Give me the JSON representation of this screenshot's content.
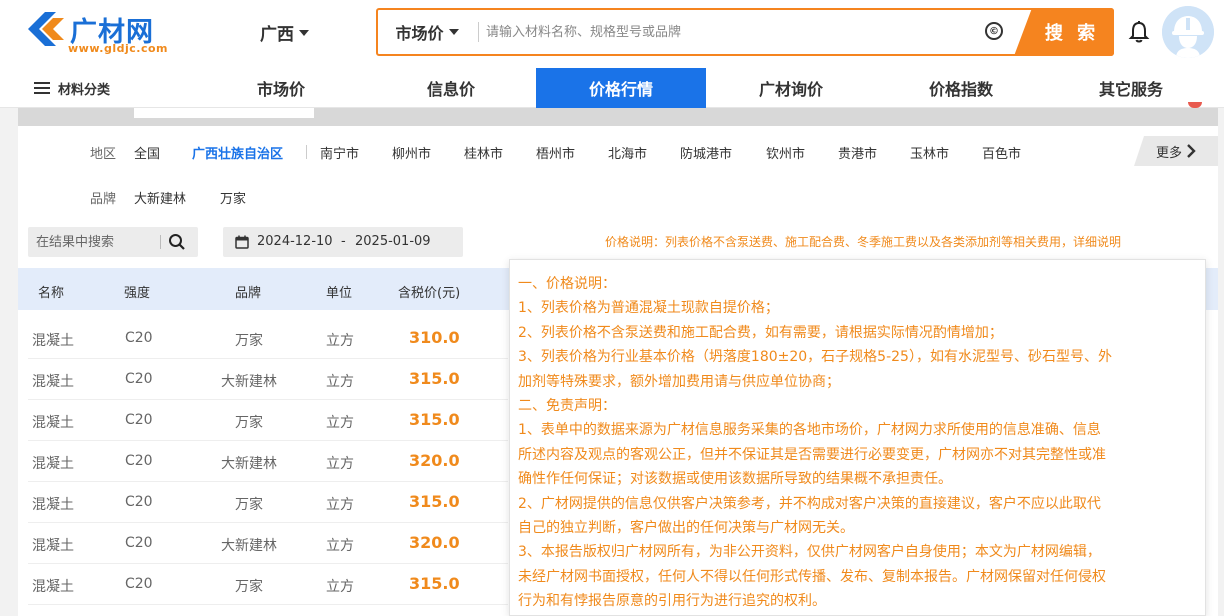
{
  "header": {
    "logo_text": "广材网",
    "logo_sub": "www.gldjc.com",
    "region": "广西",
    "search_type": "市场价",
    "search_placeholder": "请输入材料名称、规格型号或品牌",
    "c_icon": "©",
    "search_button": "搜 索"
  },
  "nav": {
    "category": "材料分类",
    "items": [
      "市场价",
      "信息价",
      "价格行情",
      "广材询价",
      "价格指数",
      "其它服务"
    ],
    "active_index": 2
  },
  "filter": {
    "region_label": "地区",
    "regions": [
      "全国",
      "广西壮族自治区",
      "南宁市",
      "柳州市",
      "桂林市",
      "梧州市",
      "北海市",
      "防城港市",
      "钦州市",
      "贵港市",
      "玉林市",
      "百色市"
    ],
    "active_region": "广西壮族自治区",
    "more": "更多",
    "brand_label": "品牌",
    "brands": [
      "大新建林",
      "万家"
    ]
  },
  "results": {
    "search_placeholder": "在结果中搜索",
    "date_start": "2024-12-10",
    "date_dash": "-",
    "date_end": "2025-01-09",
    "price_note": "价格说明：列表价格不含泵送费、施工配合费、冬季施工费以及各类添加剂等相关费用，详细说明"
  },
  "table": {
    "headers": [
      "名称",
      "强度",
      "品牌",
      "单位",
      "含税价(元)"
    ],
    "rows": [
      [
        "混凝土",
        "C20",
        "万家",
        "立方",
        "310.0"
      ],
      [
        "混凝土",
        "C20",
        "大新建林",
        "立方",
        "315.0"
      ],
      [
        "混凝土",
        "C20",
        "万家",
        "立方",
        "315.0"
      ],
      [
        "混凝土",
        "C20",
        "大新建林",
        "立方",
        "320.0"
      ],
      [
        "混凝土",
        "C20",
        "万家",
        "立方",
        "315.0"
      ],
      [
        "混凝土",
        "C20",
        "大新建林",
        "立方",
        "320.0"
      ],
      [
        "混凝土",
        "C20",
        "万家",
        "立方",
        "315.0"
      ]
    ]
  },
  "tooltip": {
    "lines": [
      "一、价格说明：",
      "1、列表价格为普通混凝土现款自提价格；",
      "2、列表价格不含泵送费和施工配合费，如有需要，请根据实际情况酌情增加；",
      "3、列表价格为行业基本价格（坍落度180±20，石子规格5-25），如有水泥型号、砂石型号、外",
      "加剂等特殊要求，额外增加费用请与供应单位协商；",
      "二、免责声明：",
      "1、表单中的数据来源为广材信息服务采集的各地市场价，广材网力求所使用的信息准确、信息",
      "所述内容及观点的客观公正，但并不保证其是否需要进行必要变更，广材网亦不对其完整性或准",
      "确性作任何保证；对该数据或使用该数据所导致的结果概不承担责任。",
      "2、广材网提供的信息仅供客户决策参考，并不构成对客户决策的直接建议，客户不应以此取代",
      "自己的独立判断，客户做出的任何决策与广材网无关。",
      "3、本报告版权归广材网所有，为非公开资料，仅供广材网客户自身使用；本文为广材网编辑，",
      "未经广材网书面授权，任何人不得以任何形式传播、发布、复制本报告。广材网保留对任何侵权",
      "行为和有悖报告原意的引用行为进行追究的权利。"
    ]
  },
  "colors": {
    "brand_blue": "#1a73e8",
    "accent_orange": "#f5841f",
    "price_orange": "#f08a1c"
  }
}
